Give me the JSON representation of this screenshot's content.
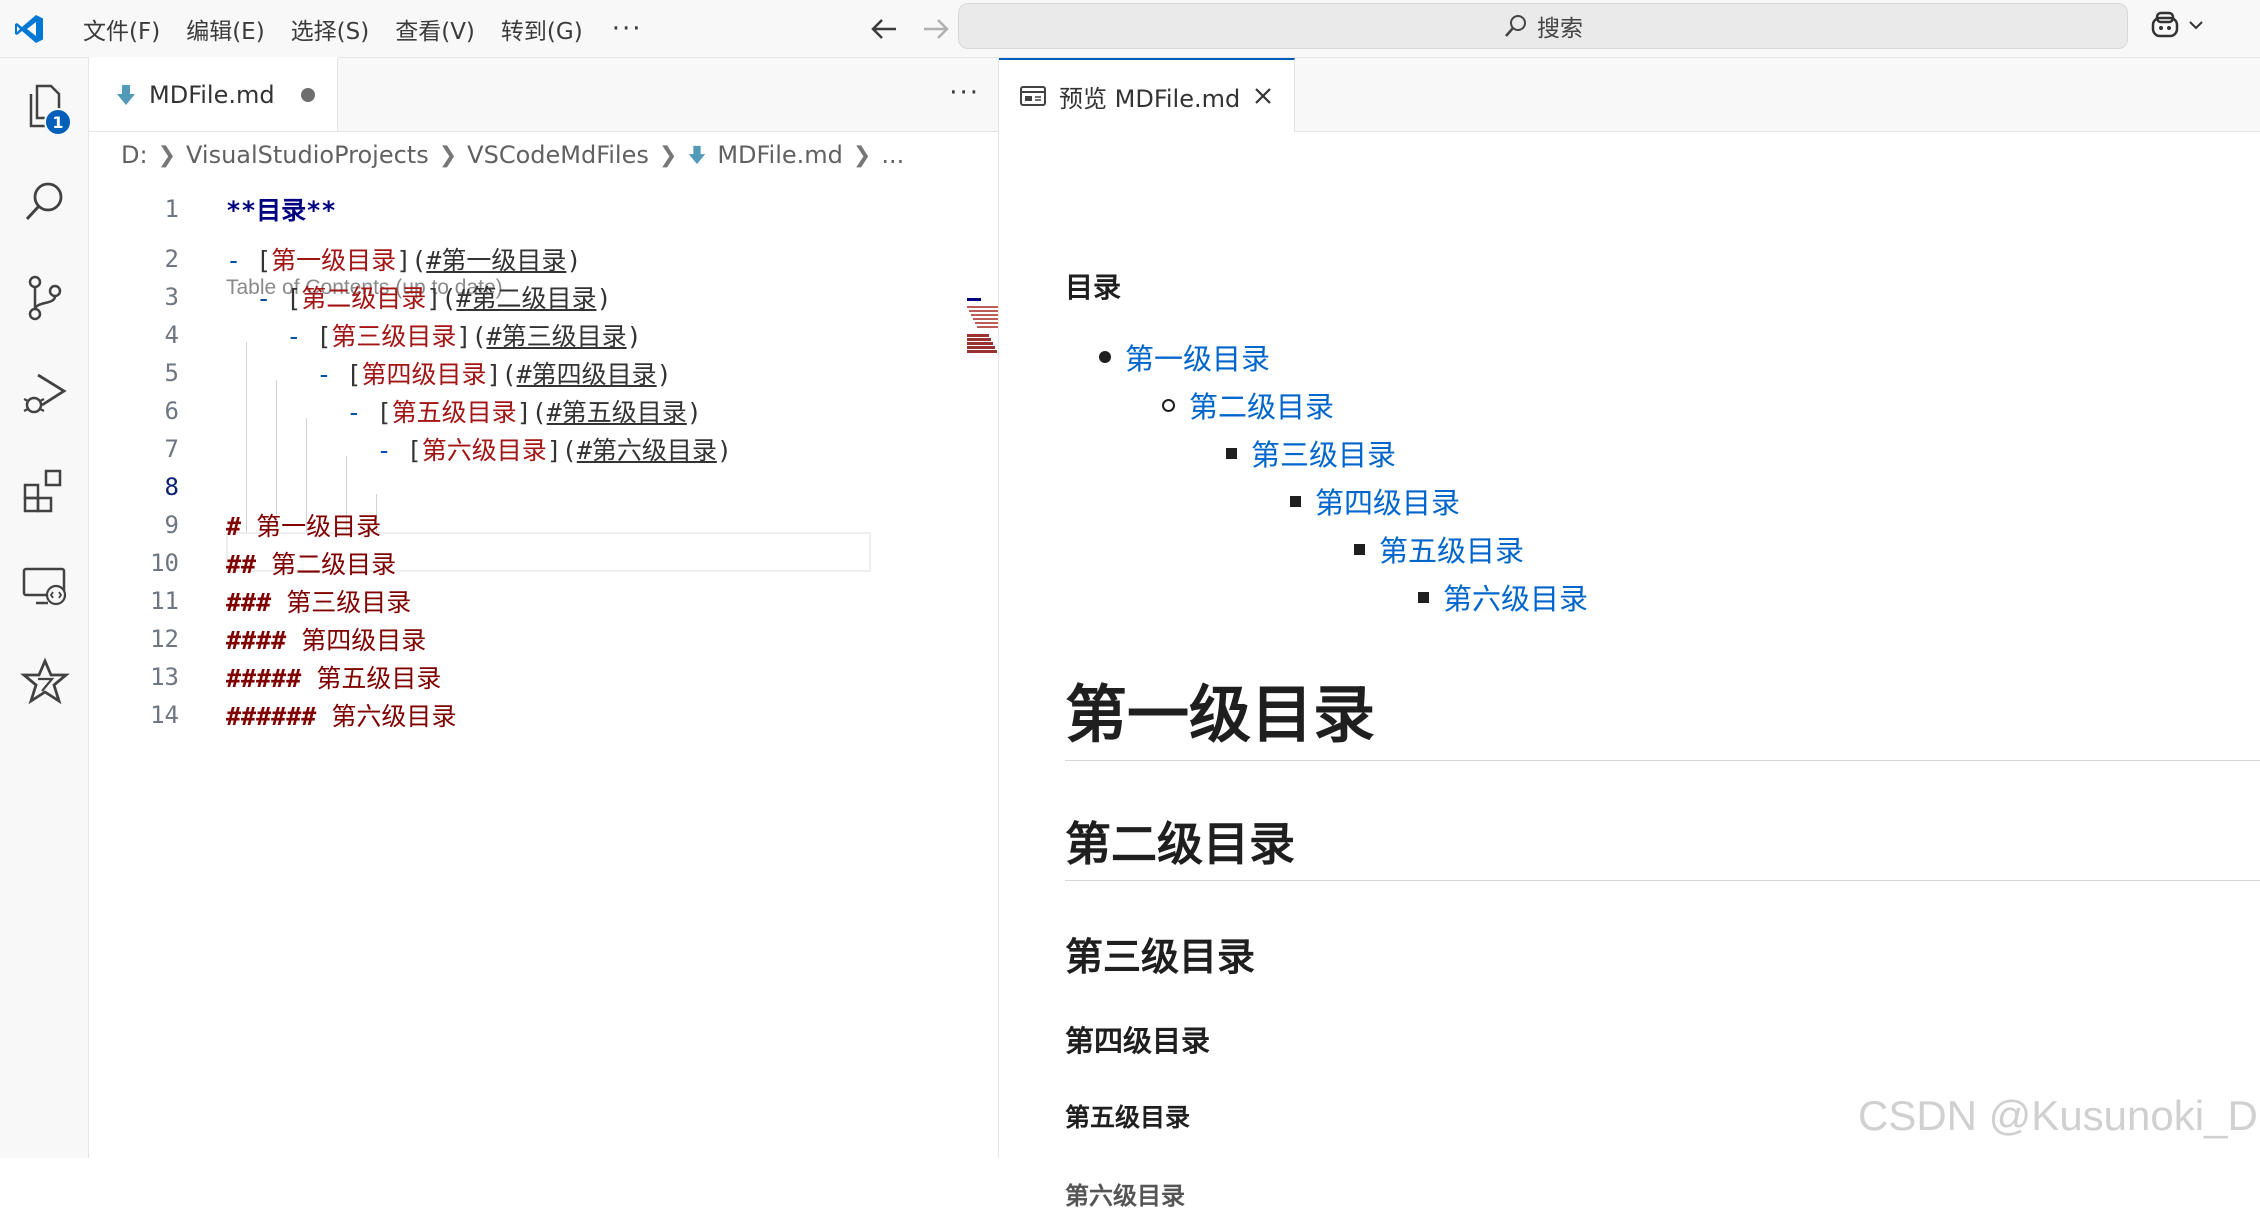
{
  "menu": {
    "items": [
      "文件(F)",
      "编辑(E)",
      "选择(S)",
      "查看(V)",
      "转到(G)"
    ],
    "more": "···"
  },
  "search": {
    "placeholder": "搜索"
  },
  "activity": {
    "explorer_badge": "1"
  },
  "editor": {
    "tab_label": "MDFile.md",
    "tabs_more": "···",
    "breadcrumb": [
      "D:",
      "VisualStudioProjects",
      "VSCodeMdFiles",
      "MDFile.md",
      "..."
    ],
    "codelens": "Table of Contents (up to date)",
    "lines": [
      {
        "n": "1",
        "parts": [
          [
            "bold",
            "**目录**"
          ]
        ]
      },
      {
        "n": "2",
        "parts": [
          [
            "kw",
            "- "
          ],
          [
            "plain",
            "["
          ],
          [
            "lt",
            "第一级目录"
          ],
          [
            "plain",
            "]("
          ],
          [
            "lnk",
            "#第一级目录"
          ],
          [
            "plain",
            ")"
          ]
        ]
      },
      {
        "n": "3",
        "parts": [
          [
            "plain",
            "  "
          ],
          [
            "kw",
            "- "
          ],
          [
            "plain",
            "["
          ],
          [
            "lt",
            "第二级目录"
          ],
          [
            "plain",
            "]("
          ],
          [
            "lnk",
            "#第二级目录"
          ],
          [
            "plain",
            ")"
          ]
        ]
      },
      {
        "n": "4",
        "parts": [
          [
            "plain",
            "    "
          ],
          [
            "kw",
            "- "
          ],
          [
            "plain",
            "["
          ],
          [
            "lt",
            "第三级目录"
          ],
          [
            "plain",
            "]("
          ],
          [
            "lnk",
            "#第三级目录"
          ],
          [
            "plain",
            ")"
          ]
        ]
      },
      {
        "n": "5",
        "parts": [
          [
            "plain",
            "      "
          ],
          [
            "kw",
            "- "
          ],
          [
            "plain",
            "["
          ],
          [
            "lt",
            "第四级目录"
          ],
          [
            "plain",
            "]("
          ],
          [
            "lnk",
            "#第四级目录"
          ],
          [
            "plain",
            ")"
          ]
        ]
      },
      {
        "n": "6",
        "parts": [
          [
            "plain",
            "        "
          ],
          [
            "kw",
            "- "
          ],
          [
            "plain",
            "["
          ],
          [
            "lt",
            "第五级目录"
          ],
          [
            "plain",
            "]("
          ],
          [
            "lnk",
            "#第五级目录"
          ],
          [
            "plain",
            ")"
          ]
        ]
      },
      {
        "n": "7",
        "parts": [
          [
            "plain",
            "          "
          ],
          [
            "kw",
            "- "
          ],
          [
            "plain",
            "["
          ],
          [
            "lt",
            "第六级目录"
          ],
          [
            "plain",
            "]("
          ],
          [
            "lnk",
            "#第六级目录"
          ],
          [
            "plain",
            ")"
          ]
        ]
      },
      {
        "n": "8",
        "parts": []
      },
      {
        "n": "9",
        "parts": [
          [
            "hdm",
            "#"
          ],
          [
            "hd",
            " 第一级目录"
          ]
        ]
      },
      {
        "n": "10",
        "parts": [
          [
            "hdm",
            "##"
          ],
          [
            "hd",
            " 第二级目录"
          ]
        ]
      },
      {
        "n": "11",
        "parts": [
          [
            "hdm",
            "###"
          ],
          [
            "hd",
            " 第三级目录"
          ]
        ]
      },
      {
        "n": "12",
        "parts": [
          [
            "hdm",
            "####"
          ],
          [
            "hd",
            " 第四级目录"
          ]
        ]
      },
      {
        "n": "13",
        "parts": [
          [
            "hdm",
            "#####"
          ],
          [
            "hd",
            " 第五级目录"
          ]
        ]
      },
      {
        "n": "14",
        "parts": [
          [
            "hdm",
            "######"
          ],
          [
            "hd",
            " 第六级目录"
          ]
        ]
      }
    ]
  },
  "preview": {
    "tab_label": "预览 MDFile.md",
    "toc_title": "目录",
    "toc": [
      "第一级目录",
      "第二级目录",
      "第三级目录",
      "第四级目录",
      "第五级目录",
      "第六级目录"
    ],
    "headings": [
      "第一级目录",
      "第二级目录",
      "第三级目录",
      "第四级目录",
      "第五级目录",
      "第六级目录"
    ]
  },
  "watermark": "CSDN @Kusunoki_D",
  "colors": {
    "accent": "#005fb8",
    "link": "#0066cc",
    "heading_md": "#800000"
  }
}
